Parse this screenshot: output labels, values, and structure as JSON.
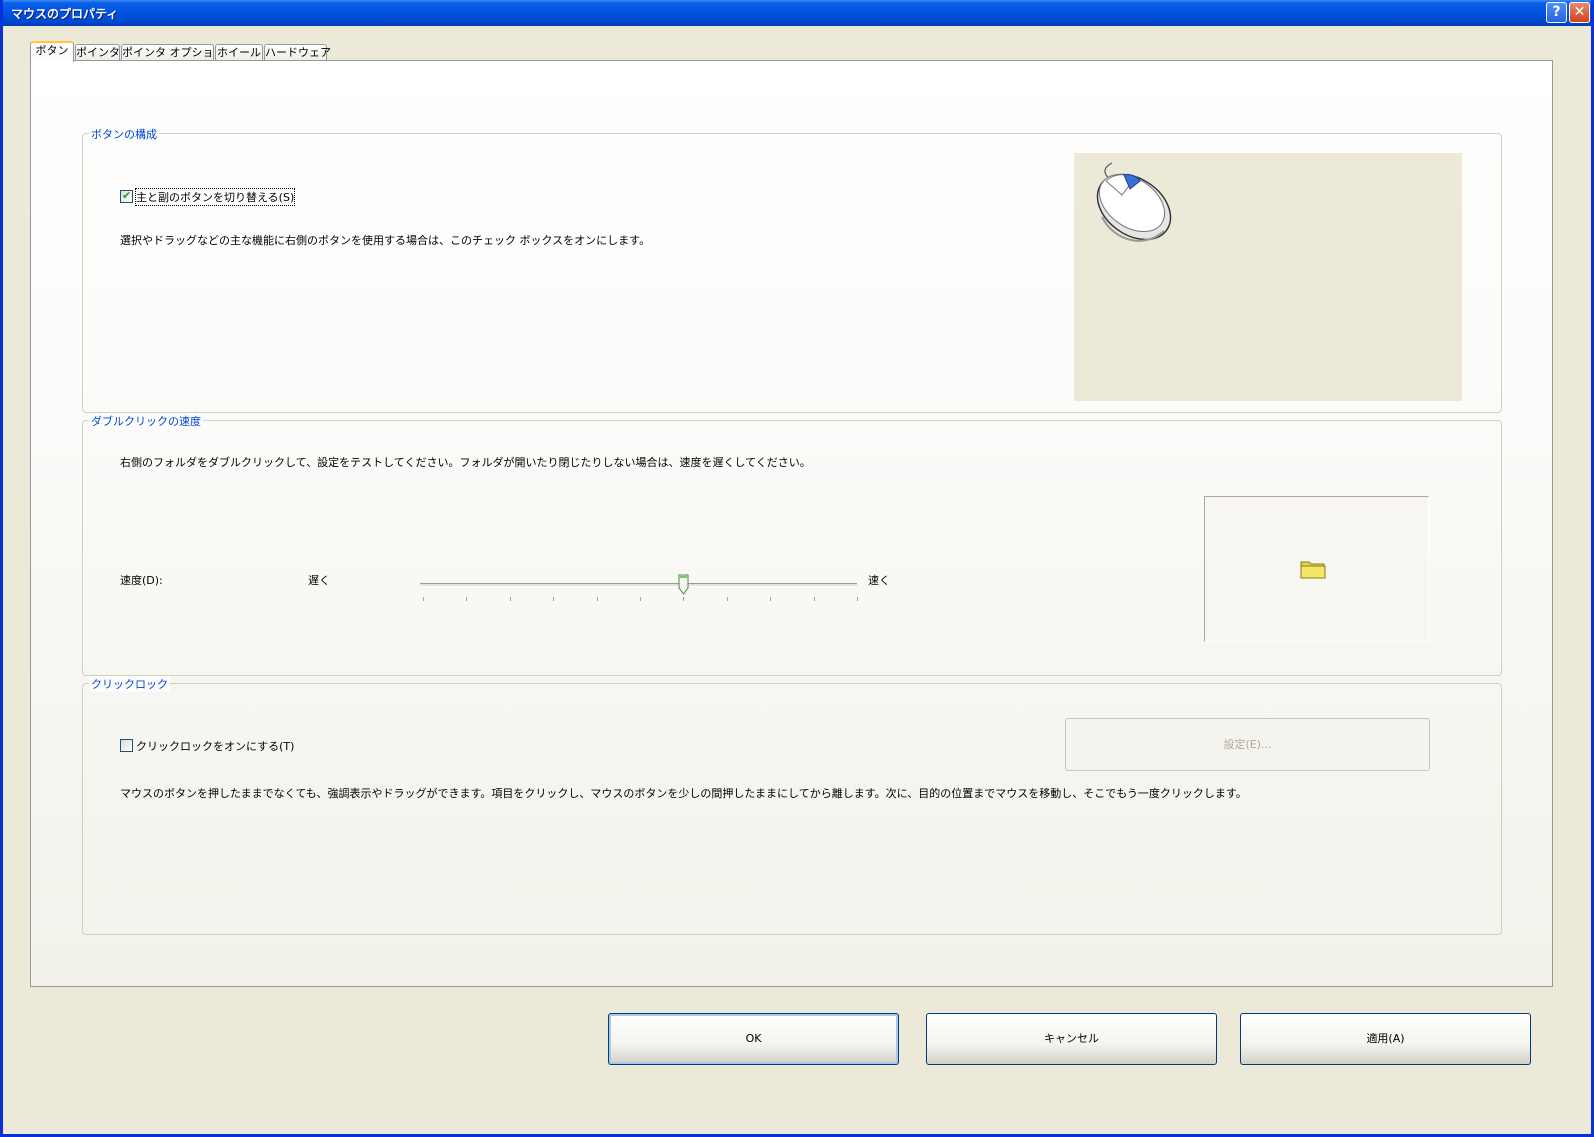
{
  "window": {
    "title": "マウスのプロパティ",
    "help_glyph": "?",
    "close_glyph": "✕"
  },
  "tabs": [
    {
      "label": "ボタン",
      "active": true
    },
    {
      "label": "ポインタ",
      "active": false
    },
    {
      "label": "ポインタ オプション",
      "active": false
    },
    {
      "label": "ホイール",
      "active": false
    },
    {
      "label": "ハードウェア",
      "active": false
    }
  ],
  "button_config": {
    "legend": "ボタンの構成",
    "swap_checkbox_label": "主と副のボタンを切り替える(S)",
    "swap_checked": true,
    "description": "選択やドラッグなどの主な機能に右側のボタンを使用する場合は、このチェック ボックスをオンにします。"
  },
  "double_click": {
    "legend": "ダブルクリックの速度",
    "description": "右側のフォルダをダブルクリックして、設定をテストしてください。フォルダが開いたり閉じたりしない場合は、速度を遅くしてください。",
    "speed_label": "速度(D):",
    "slow_label": "遅く",
    "fast_label": "速く",
    "slider_value": 6,
    "slider_max": 10
  },
  "click_lock": {
    "legend": "クリックロック",
    "checkbox_label": "クリックロックをオンにする(T)",
    "checked": false,
    "settings_button": "設定(E)...",
    "description": "マウスのボタンを押したままでなくても、強調表示やドラッグができます。項目をクリックし、マウスのボタンを少しの間押したままにしてから離します。次に、目的の位置までマウスを移動し、そこでもう一度クリックします。"
  },
  "footer": {
    "ok": "OK",
    "cancel": "キャンセル",
    "apply": "適用(A)"
  },
  "colors": {
    "title_bar": "#0053e1",
    "legend_text": "#0046d5",
    "dialog_bg": "#ece9d8"
  }
}
